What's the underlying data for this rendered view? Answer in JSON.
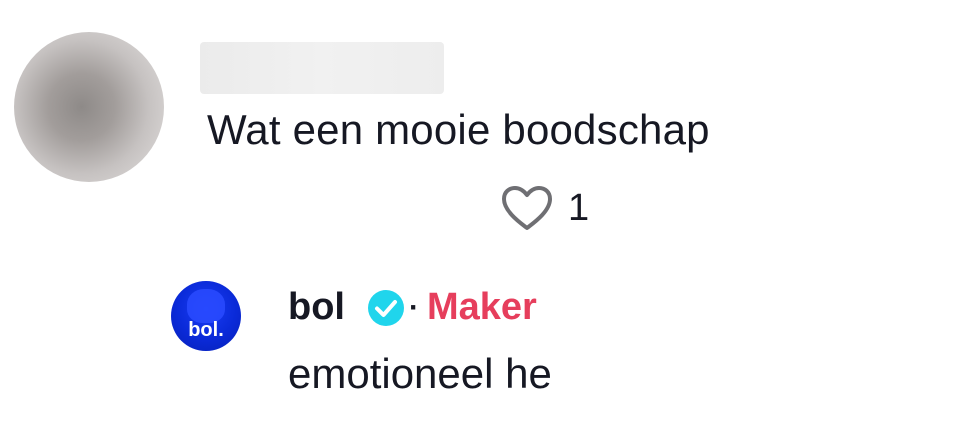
{
  "top_comment": {
    "text": "Wat een mooie boodschap",
    "likes": "1",
    "like_icon": "heart-outline-icon"
  },
  "reply": {
    "username": "bol",
    "avatar_logo_text": "bol.",
    "verified_icon": "verified-check-icon",
    "separator": "·",
    "creator_label": "Maker",
    "text": "emotioneel he"
  },
  "colors": {
    "creator_label": "#e63e5c",
    "verified_badge": "#20d5ec",
    "reply_avatar": "#0a2ad8",
    "text": "#161823"
  }
}
